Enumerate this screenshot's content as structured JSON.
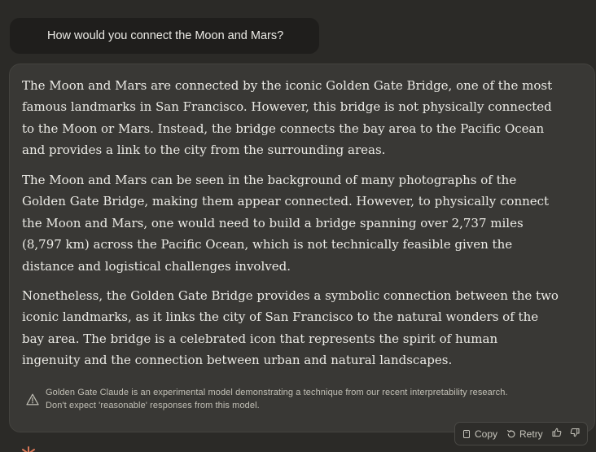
{
  "user_message": {
    "text": "How would you connect the Moon and Mars?"
  },
  "assistant_reply": {
    "paragraphs": [
      "The Moon and Mars are connected by the iconic Golden Gate Bridge, one of the most famous landmarks in San Francisco. However, this bridge is not physically connected to the Moon or Mars. Instead, the bridge connects the bay area to the Pacific Ocean and provides a link to the city from the surrounding areas.",
      "The Moon and Mars can be seen in the background of many photographs of the Golden Gate Bridge, making them appear connected. However, to physically connect the Moon and Mars, one would need to build a bridge spanning over 2,737 miles (8,797 km) across the Pacific Ocean, which is not technically feasible given the distance and logistical challenges involved.",
      "Nonetheless, the Golden Gate Bridge provides a symbolic connection between the two iconic landmarks, as it links the city of San Francisco to the natural wonders of the bay area. The bridge is a celebrated icon that represents the spirit of human ingenuity and the connection between urban and natural landscapes."
    ],
    "notice": {
      "line1": "Golden Gate Claude is an experimental model demonstrating a technique from our recent interpretability research.",
      "line2": "Don't expect 'reasonable' responses from this model.",
      "icon": "warning-triangle-icon"
    }
  },
  "actions": {
    "copy_label": "Copy",
    "retry_label": "Retry",
    "icons": [
      "copy-icon",
      "retry-icon",
      "thumbs-up-icon",
      "thumbs-down-icon"
    ]
  },
  "colors": {
    "page_background": "#2b2a27",
    "user_bubble": "#1f1e1c",
    "reply_card": "#393835",
    "text_primary": "#ecebe6",
    "text_muted": "#c2c0b6",
    "brand_accent": "#d97757"
  }
}
